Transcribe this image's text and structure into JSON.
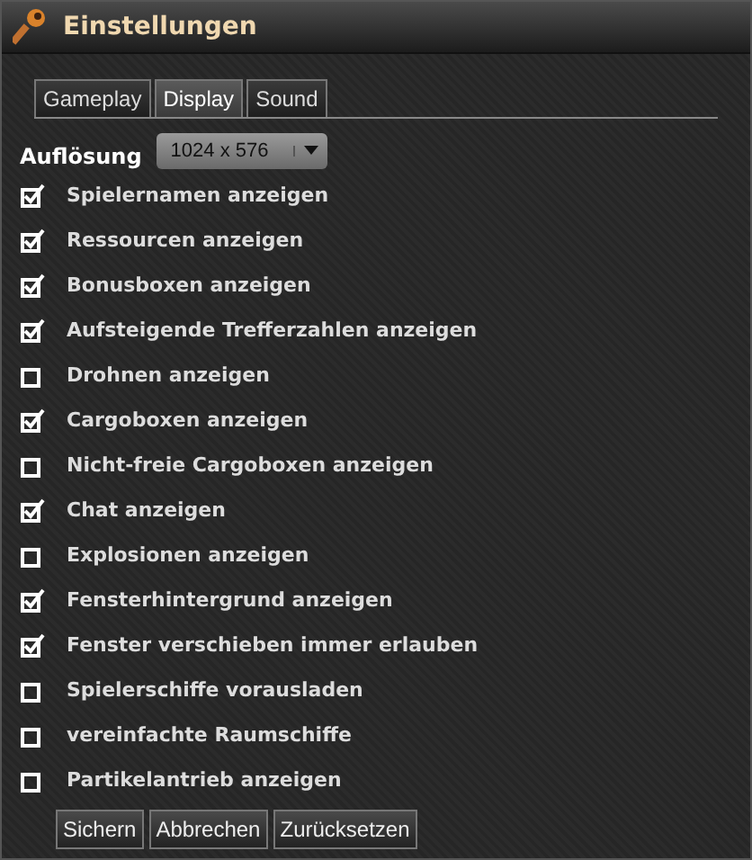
{
  "window": {
    "title": "Einstellungen"
  },
  "tabs": [
    {
      "label": "Gameplay",
      "selected": false
    },
    {
      "label": "Display",
      "selected": true
    },
    {
      "label": "Sound",
      "selected": false
    }
  ],
  "resolution": {
    "label": "Auflösung",
    "value": "1024 x 576"
  },
  "options": [
    {
      "label": "Spielernamen anzeigen",
      "checked": true
    },
    {
      "label": "Ressourcen anzeigen",
      "checked": true
    },
    {
      "label": "Bonusboxen anzeigen",
      "checked": true
    },
    {
      "label": "Aufsteigende Trefferzahlen anzeigen",
      "checked": true
    },
    {
      "label": "Drohnen anzeigen",
      "checked": false
    },
    {
      "label": "Cargoboxen anzeigen",
      "checked": true
    },
    {
      "label": "Nicht-freie Cargoboxen anzeigen",
      "checked": false
    },
    {
      "label": "Chat anzeigen",
      "checked": true
    },
    {
      "label": "Explosionen anzeigen",
      "checked": false
    },
    {
      "label": "Fensterhintergrund anzeigen",
      "checked": true
    },
    {
      "label": "Fenster verschieben immer erlauben",
      "checked": true
    },
    {
      "label": "Spielerschiffe vorausladen",
      "checked": false
    },
    {
      "label": "vereinfachte Raumschiffe",
      "checked": false
    },
    {
      "label": "Partikelantrieb anzeigen",
      "checked": false
    }
  ],
  "buttons": [
    "Sichern",
    "Abbrechen",
    "Zurücksetzen"
  ]
}
